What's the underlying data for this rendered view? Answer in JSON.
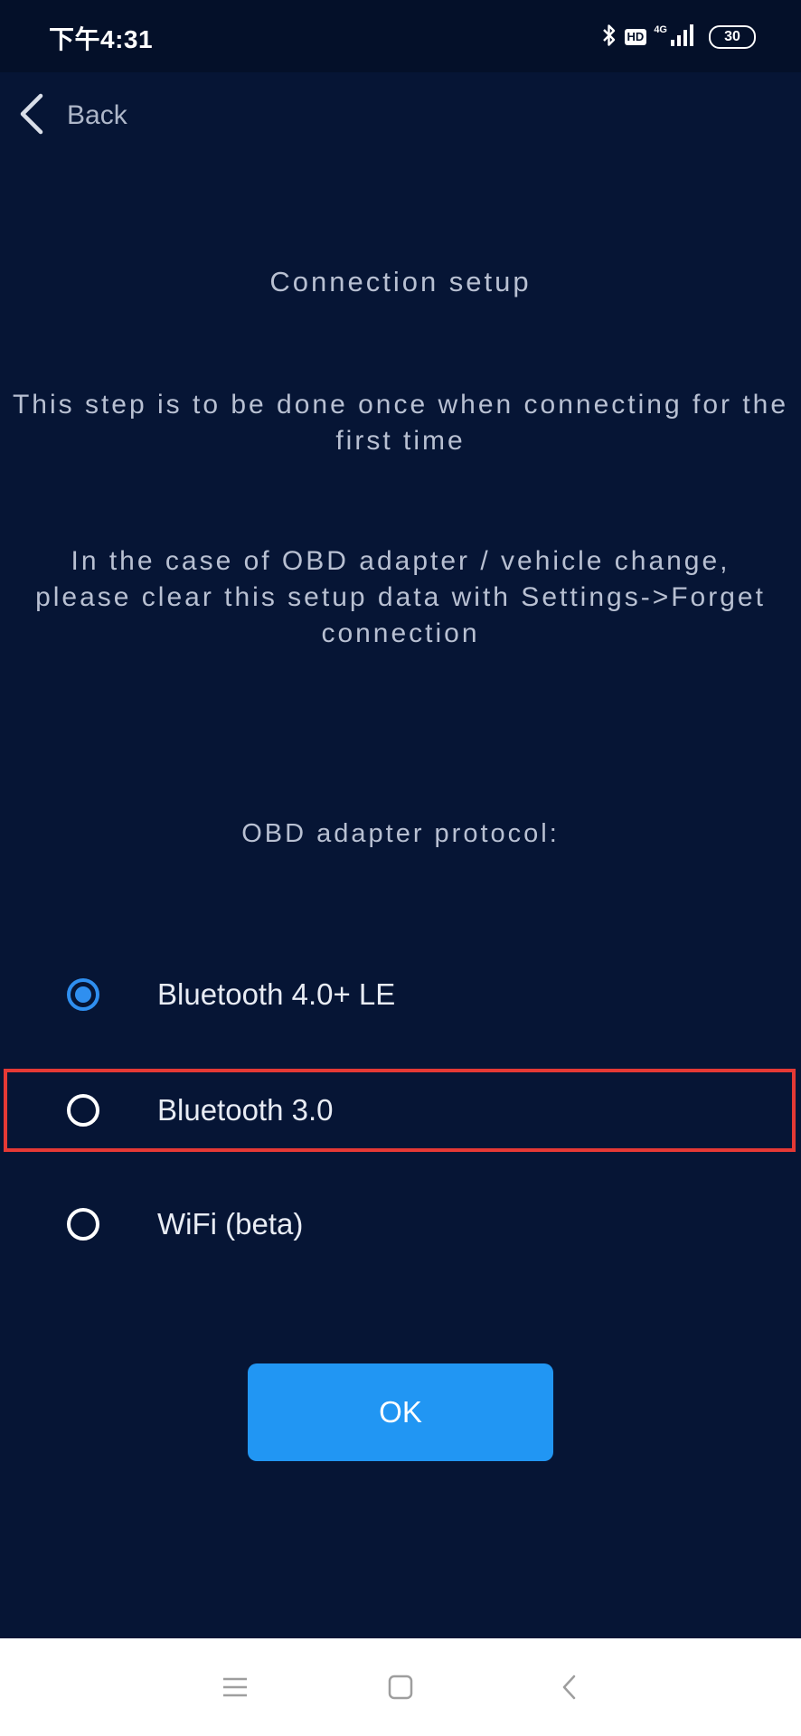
{
  "status_bar": {
    "time": "下午4:31",
    "hd_badge": "HD",
    "network": "4G",
    "battery_level": "30",
    "icons": [
      "bluetooth-icon",
      "hd-icon",
      "signal-icon",
      "battery-icon"
    ]
  },
  "header": {
    "back_label": "Back"
  },
  "content": {
    "title": "Connection setup",
    "paragraph1": "This step is to be done once when connecting for the first time",
    "paragraph2": "In the case of OBD adapter / vehicle change, please clear this setup data with Settings->Forget connection",
    "protocol_label": "OBD adapter protocol:"
  },
  "protocol_options": [
    {
      "label": "Bluetooth 4.0+ LE",
      "selected": true
    },
    {
      "label": "Bluetooth 3.0",
      "selected": false
    },
    {
      "label": "WiFi (beta)",
      "selected": false
    }
  ],
  "ok_button": {
    "label": "OK"
  },
  "colors": {
    "background": "#061535",
    "accent": "#2196f3",
    "radio_selected": "#2f8ff0",
    "highlight": "#e53935"
  },
  "nav_bar": {
    "icons": [
      "menu-icon",
      "home-icon",
      "back-nav-icon"
    ]
  }
}
